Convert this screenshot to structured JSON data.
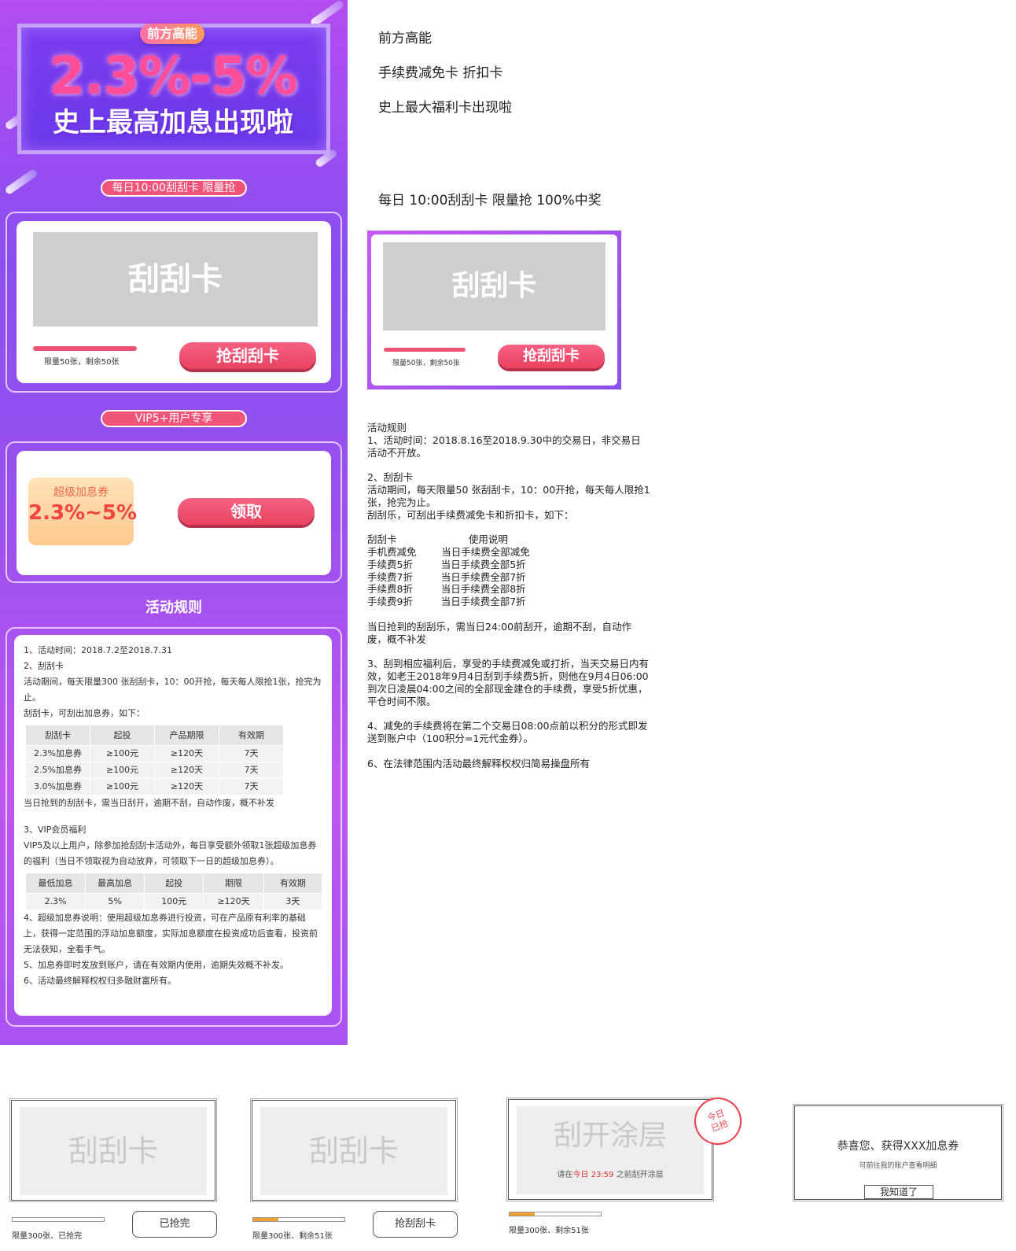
{
  "promo": {
    "badge": "前方高能",
    "rate": "2.3%-5%",
    "subtitle": "史上最高加息出现啦",
    "daily_pill": "每日10:00刮刮卡  限量抢",
    "scratch_label": "刮刮卡",
    "quota": "限量50张，剩余50张",
    "grab_button": "抢刮刮卡",
    "vip_pill": "VIP5+用户专享",
    "coupon_label": "超级加息券",
    "coupon_value": "2.3%~5%",
    "claim_button": "领取",
    "rules_title": "活动规则",
    "rules": {
      "l1": "1、活动时间：2018.7.2至2018.7.31",
      "l2": "2、刮刮卡",
      "l3": "活动期间，每天限量300 张刮刮卡，10：00开抢，每天每人限抢1张，抢完为止。",
      "l4": "刮刮卡，可刮出加息券，如下：",
      "table1": {
        "headers": [
          "刮刮卡",
          "起投",
          "产品期限",
          "有效期"
        ],
        "rows": [
          [
            "2.3%加息券",
            "≥100元",
            "≥120天",
            "7天"
          ],
          [
            "2.5%加息券",
            "≥100元",
            "≥120天",
            "7天"
          ],
          [
            "3.0%加息券",
            "≥100元",
            "≥120天",
            "7天"
          ]
        ]
      },
      "l5": "当日抢到的刮刮卡，需当日刮开，逾期不刮，自动作废，概不补发",
      "l6": "3、VIP会员福利",
      "l7": "VIP5及以上用户，除参加抢刮刮卡活动外，每日享受额外领取1张超级加息券的福利（当日不领取视为自动放弃，可领取下一日的超级加息券）。",
      "table2": {
        "headers": [
          "最低加息",
          "最高加息",
          "起投",
          "期限",
          "有效期"
        ],
        "rows": [
          [
            "2.3%",
            "5%",
            "100元",
            "≥120天",
            "3天"
          ]
        ]
      },
      "l8": "4、超级加息券说明：使用超级加息券进行投资，可在产品原有利率的基础上，获得一定范围的浮动加息额度，实际加息额度在投资成功后查看，投资前无法获知，全看手气。",
      "l9": "5、加息券即时发放到账户，请在有效期内使用，逾期失效概不补发。",
      "l10": "6、活动最终解释权权归多融财富所有。"
    }
  },
  "notes": {
    "t1": "前方高能",
    "t2": "手续费减免卡 折扣卡",
    "t3": "史上最大福利卡出现啦",
    "t4": "每日 10:00刮刮卡 限量抢 100%中奖",
    "card_label": "刮刮卡",
    "card_quota": "限量50张，剩余50张",
    "card_button": "抢刮刮卡",
    "rules_text": "活动规则\n1、活动时间：2018.8.16至2018.9.30中的交易日，非交易日活动不开放。\n\n2、刮刮卡\n活动期间，每天限量50 张刮刮卡，10：00开抢，每天每人限抢1张，抢完为止。\n刮刮乐，可刮出手续费减免卡和折扣卡，如下：\n\n刮刮卡                       使用说明\n手机费减免        当日手续费全部减免\n手续费5折         当日手续费全部5折\n手续费7折         当日手续费全部7折\n手续费8折         当日手续费全部8折\n手续费9折         当日手续费全部7折\n\n当日抢到的刮刮乐，需当日24:00前刮开，逾期不刮，自动作废，概不补发\n\n3、刮到相应福利后，享受的手续费减免或打折，当天交易日内有效，如老王2018年9月4日刮到手续费5折，则他在9月4日06:00到次日凌晨04:00之间的全部现金建仓的手续费，享受5折优惠，平仓时间不限。\n\n4、减免的手续费将在第二个交易日08:00点前以积分的形式即发送到账户中（100积分=1元代金券）。\n\n6、在法律范围内活动最终解释权权归简易操盘所有"
  },
  "wireframes": {
    "w1": {
      "label": "刮刮卡",
      "quota": "限量300张、已抢完",
      "button": "已抢完",
      "progress": 0
    },
    "w2": {
      "label": "刮刮卡",
      "quota": "限量300张、剩余51张",
      "button": "抢刮刮卡",
      "progress": 0.28
    },
    "w3": {
      "label": "刮开涂层",
      "hint_pre": "请在",
      "hint_today": "今日",
      "hint_time": " 23:59 ",
      "hint_post": "之前刮开涂层",
      "stamp_l1": "今日",
      "stamp_l2": "已抢",
      "quota": "限量300张、剩余51张",
      "progress": 0.28
    },
    "w4": {
      "title": "恭喜您、获得XXX加息券",
      "sub": "可前往我的账户查看明细",
      "button": "我知道了"
    }
  },
  "colors": {
    "accent": "#ef5476",
    "purple": "#8a4ef0",
    "orange": "#f0a030"
  }
}
